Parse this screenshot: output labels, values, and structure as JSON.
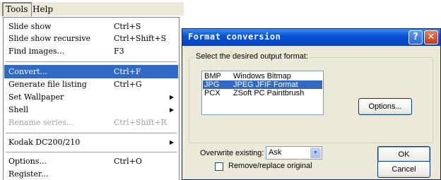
{
  "menubar": {
    "tools": "Tools",
    "help": "Help"
  },
  "tools_menu": {
    "items": [
      {
        "label": "Slide show",
        "shortcut": "Ctrl+S"
      },
      {
        "label": "Slide show recursive",
        "shortcut": "Ctrl+Shift+S"
      },
      {
        "label": "Find images...",
        "shortcut": "F3"
      },
      {
        "label": "Convert...",
        "shortcut": "Ctrl+F"
      },
      {
        "label": "Generate file listing",
        "shortcut": "Ctrl+G"
      },
      {
        "label": "Set Wallpaper",
        "shortcut": ""
      },
      {
        "label": "Shell",
        "shortcut": ""
      },
      {
        "label": "Rename series...",
        "shortcut": "Ctrl+Shift+R"
      },
      {
        "label": "Kodak DC200/210",
        "shortcut": ""
      },
      {
        "label": "Options...",
        "shortcut": "Ctrl+O"
      },
      {
        "label": "Register...",
        "shortcut": ""
      }
    ],
    "submenu_arrow": "▶"
  },
  "dialog": {
    "title": "Format conversion",
    "help_glyph": "?",
    "close_glyph": "✕",
    "group_label": "Select the desired output format:",
    "formats": [
      {
        "ext": "BMP",
        "name": "Windows Bitmap"
      },
      {
        "ext": "JPG",
        "name": "JPEG JFIF Format"
      },
      {
        "ext": "PCX",
        "name": "ZSoft PC Paintbrush"
      }
    ],
    "options_button": "Options...",
    "overwrite_label": "Overwrite existing:",
    "overwrite_value": "Ask",
    "combo_arrow": "▼",
    "ok_button": "OK",
    "cancel_button": "Cancel",
    "remove_label": "Remove/replace original",
    "colors": {
      "title_blue": "#0a54d9",
      "selection": "#316ac5",
      "dialog_bg": "#ece9d8"
    }
  }
}
